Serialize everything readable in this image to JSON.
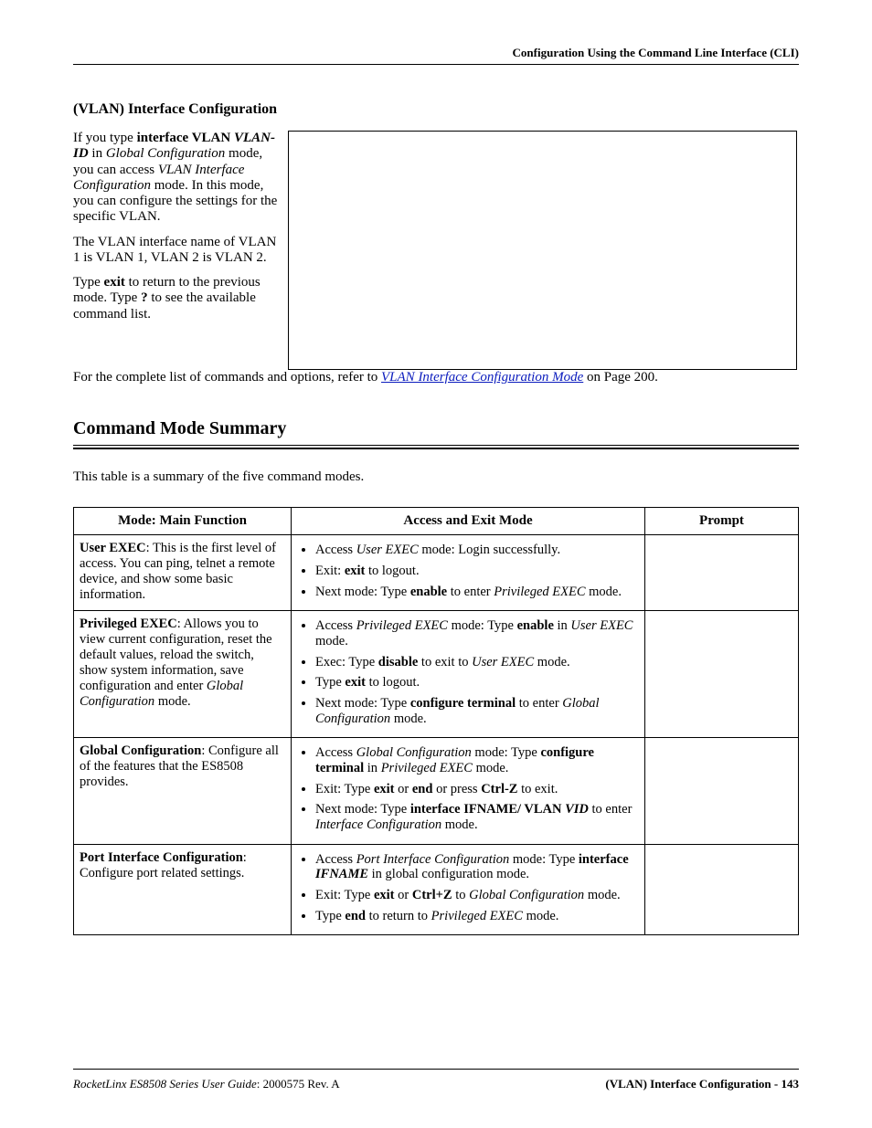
{
  "runningHead": "Configuration Using the Command Line Interface (CLI)",
  "section": {
    "title": "(VLAN) Interface Configuration",
    "p1": {
      "t1": "If you type ",
      "b1": "interface VLAN ",
      "i1": "VLAN-ID",
      "t2": " in ",
      "i2": "Global Configuration",
      "t3": " mode, you can access ",
      "i3": "VLAN Interface Configuration",
      "t4": " mode. In this mode, you can configure the settings for the specific VLAN."
    },
    "p2": "The VLAN interface name of VLAN 1 is VLAN 1, VLAN 2 is VLAN 2.",
    "p3": {
      "t1": "Type ",
      "b1": "exit",
      "t2": " to return to the previous mode. Type ",
      "b2": "?",
      "t3": " to see the available command list."
    },
    "p4": {
      "t1": "For the complete list of commands and options, refer to ",
      "link": "VLAN Interface Configuration Mode",
      "t2": " on Page 200."
    }
  },
  "summary": {
    "heading": "Command Mode Summary",
    "intro": "This table is a summary of the five command modes.",
    "headers": {
      "c1": "Mode: Main Function",
      "c2": "Access and Exit Mode",
      "c3": "Prompt"
    },
    "rows": [
      {
        "mode_b": "User EXEC",
        "mode_rest": ": This is the first level of access. You can ping, telnet a remote device, and show some basic information.",
        "bullets": [
          {
            "pre": "Access ",
            "i1": "User EXEC",
            "mid": " mode: Login successfully.",
            "b1": "",
            "post": ""
          },
          {
            "pre": "Exit: ",
            "b1": "exit",
            "mid": " to logout.",
            "i1": "",
            "post": ""
          },
          {
            "pre": "Next mode: Type ",
            "b1": "enable",
            "mid": " to enter ",
            "i1": "Privileged EXEC",
            "post": " mode."
          }
        ],
        "prompt": ""
      },
      {
        "mode_b": "Privileged EXEC",
        "mode_rest": ": Allows you to view current configuration, reset the default values, reload the switch, show system information, save configuration and enter ",
        "mode_i": "Global Configuration",
        "mode_tail": " mode.",
        "bullets": [
          {
            "pre": "Access ",
            "i1": "Privileged EXEC",
            "mid": " mode: Type ",
            "b1": "enable",
            "post": " in ",
            "i2": "User EXEC",
            "post2": " mode."
          },
          {
            "pre": "Exec: Type ",
            "b1": "disable",
            "mid": " to exit to ",
            "i1": "User EXEC",
            "post": " mode."
          },
          {
            "pre": "Type ",
            "b1": "exit",
            "mid": " to logout.",
            "i1": "",
            "post": ""
          },
          {
            "pre": "Next mode: Type ",
            "b1": "configure terminal",
            "mid": " to enter ",
            "i1": "Global Configuration",
            "post": " mode."
          }
        ],
        "prompt": ""
      },
      {
        "mode_b": "Global Configuration",
        "mode_rest": ": Configure all of the features that the ES8508 provides.",
        "bullets": [
          {
            "pre": "Access ",
            "i1": "Global Configuration",
            "mid": " mode: Type ",
            "b1": "configure terminal",
            "post": " in ",
            "i2": "Privileged EXEC",
            "post2": " mode."
          },
          {
            "pre": "Exit: Type ",
            "b1": "exit",
            "mid": " or ",
            "b2": "end",
            "mid2": " or press ",
            "b3": "Ctrl-Z",
            "post": " to exit."
          },
          {
            "pre": "Next mode: Type ",
            "b1": "interface IFNAME/ VLAN ",
            "i1": "VID",
            "mid": " to enter ",
            "i2": "Interface Configuration",
            "post": " mode."
          }
        ],
        "prompt": ""
      },
      {
        "mode_b": "Port Interface Configuration",
        "mode_rest": ": Configure port related settings.",
        "bullets": [
          {
            "pre": "Access ",
            "i1": "Port Interface Configuration",
            "mid": " mode: Type ",
            "b1": "interface ",
            "bi1": "IFNAME",
            "post": " in global configuration mode."
          },
          {
            "pre": "Exit: Type ",
            "b1": "exit",
            "mid": " or ",
            "b2": "Ctrl+Z",
            "mid2": " to ",
            "i1": "Global Configuration",
            "post": " mode."
          },
          {
            "pre": "Type ",
            "b1": "end",
            "mid": " to return to ",
            "i1": "Privileged EXEC",
            "post": " mode."
          }
        ],
        "prompt": ""
      }
    ]
  },
  "footer": {
    "left_i": "RocketLinx ES8508 Series  User Guide",
    "left_rest": ": 2000575 Rev. A",
    "right": "(VLAN) Interface Configuration - 143"
  }
}
